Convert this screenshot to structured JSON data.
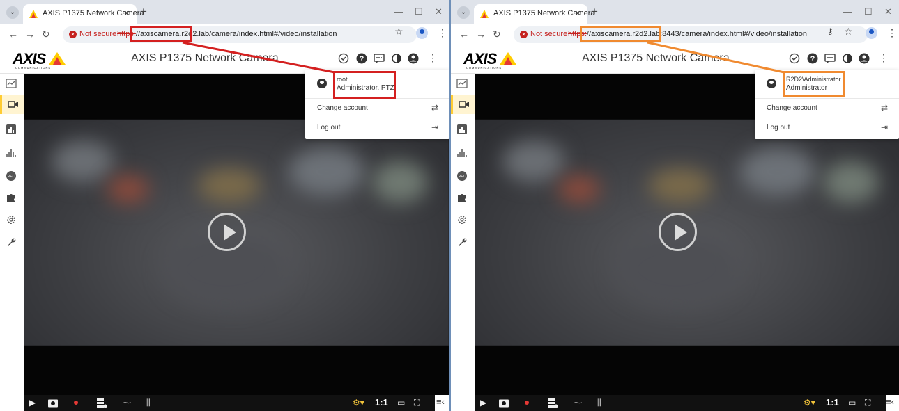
{
  "left": {
    "tab": {
      "title": "AXIS P1375 Network Camera"
    },
    "address": {
      "security": "Not secure",
      "scheme": "https:",
      "url": "//axiscamera.r2d2.lab/camera/index.html#/video/installation"
    },
    "app": {
      "title": "AXIS P1375 Network Camera"
    },
    "account": {
      "user": "root",
      "role": "Administrator, PTZ",
      "change_account": "Change account",
      "logout": "Log out"
    },
    "toolbar": {
      "ratio": "1:1"
    }
  },
  "right": {
    "tab": {
      "title": "AXIS P1375 Network Camera"
    },
    "address": {
      "security": "Not secure",
      "scheme": "https:",
      "url": "//axiscamera.r2d2.lab:8443/camera/index.html#/video/installation"
    },
    "app": {
      "title": "AXIS P1375 Network Camera"
    },
    "account": {
      "user": "R2D2\\Administrator",
      "role": "Administrator",
      "change_account": "Change account",
      "logout": "Log out"
    },
    "toolbar": {
      "ratio": "1:1"
    }
  },
  "brand": {
    "logo": "AXIS",
    "logo_sub": "COMMUNICATIONS"
  },
  "colors": {
    "highlight_left": "#d42020",
    "highlight_right": "#f08a30",
    "accent": "#ffcc33"
  },
  "icons": [
    "settings-check-icon",
    "help-icon",
    "feedback-icon",
    "contrast-icon",
    "account-icon",
    "more-icon"
  ]
}
